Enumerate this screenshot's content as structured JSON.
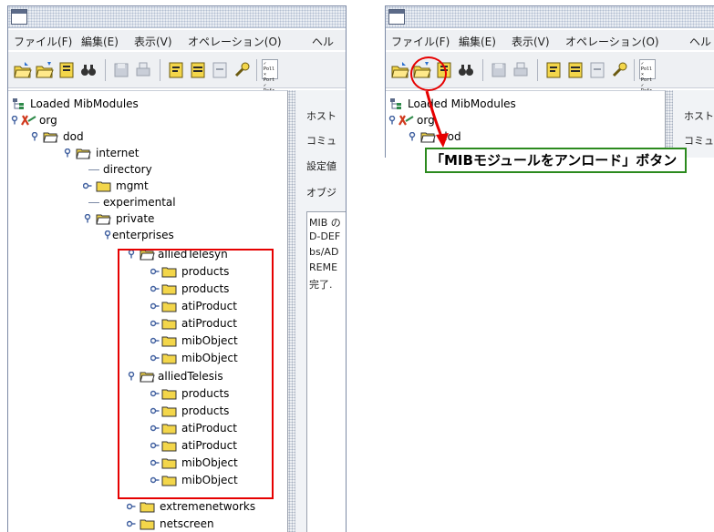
{
  "menu": {
    "file": "ファイル(F)",
    "edit": "編集(E)",
    "view": "表示(V)",
    "operation": "オペレーション(O)",
    "help_left": "ヘル",
    "help_right": "ヘル"
  },
  "toolbar_icons": [
    "load-mib-icon",
    "unload-mib-icon",
    "mib-file-icon",
    "find-icon",
    "save-icon",
    "print-icon",
    "copy-icon",
    "paste-icon",
    "graph-icon",
    "wrench-icon",
    "poll-port-refresh-icon"
  ],
  "toolbar_text": {
    "line1": "✓ Poll",
    "line2": "× Port",
    "line3": "✓ Refr"
  },
  "tree_left": [
    {
      "label": "Loaded MibModules"
    },
    {
      "label": "org"
    },
    {
      "label": "dod"
    },
    {
      "label": "internet"
    },
    {
      "label": "directory"
    },
    {
      "label": "mgmt"
    },
    {
      "label": "experimental"
    },
    {
      "label": "private"
    },
    {
      "label": "enterprises"
    },
    {
      "label": "alliedTelesyn"
    },
    {
      "label": "products"
    },
    {
      "label": "products"
    },
    {
      "label": "atiProduct"
    },
    {
      "label": "atiProduct"
    },
    {
      "label": "mibObject"
    },
    {
      "label": "mibObject"
    },
    {
      "label": "alliedTelesis"
    },
    {
      "label": "products"
    },
    {
      "label": "products"
    },
    {
      "label": "atiProduct"
    },
    {
      "label": "atiProduct"
    },
    {
      "label": "mibObject"
    },
    {
      "label": "mibObject"
    },
    {
      "label": "extremenetworks"
    },
    {
      "label": "netscreen"
    }
  ],
  "tree_right": [
    {
      "label": "Loaded MibModules"
    },
    {
      "label": "org"
    },
    {
      "label": "dod"
    }
  ],
  "right_pane": {
    "host": "ホスト",
    "community": "コミュ",
    "setting": "設定値",
    "object": "オブジ",
    "log": [
      "MIB の",
      "D-DEF",
      "bs/AD",
      "REME",
      "完了."
    ]
  },
  "right_pane_r": {
    "host": "ホスト",
    "community": "コミュ"
  },
  "callout": {
    "text": "「MIBモジュールをアンロード」ボタン"
  },
  "colors": {
    "highlight": "#e60000",
    "callout_border": "#2b8a1e",
    "folder": "#f3d64a",
    "titlebar": "#e9edf3"
  }
}
